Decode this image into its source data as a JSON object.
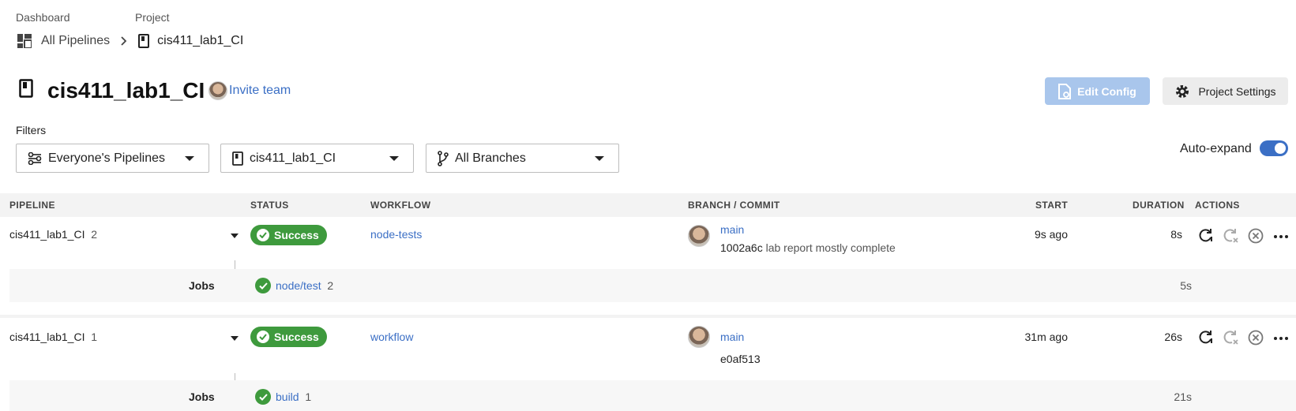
{
  "breadcrumb": {
    "dashboard_label": "Dashboard",
    "project_label": "Project",
    "all_pipelines": "All Pipelines",
    "project_name": "cis411_lab1_CI"
  },
  "header": {
    "title": "cis411_lab1_CI",
    "invite_team": "Invite team",
    "edit_config": "Edit Config",
    "project_settings": "Project Settings"
  },
  "filters": {
    "label": "Filters",
    "pipelines_select": "Everyone's Pipelines",
    "project_select": "cis411_lab1_CI",
    "branches_select": "All Branches",
    "auto_expand_label": "Auto-expand",
    "auto_expand_on": true
  },
  "table": {
    "headers": {
      "pipeline": "PIPELINE",
      "status": "STATUS",
      "workflow": "WORKFLOW",
      "branch_commit": "BRANCH / COMMIT",
      "start": "START",
      "duration": "DURATION",
      "actions": "ACTIONS"
    },
    "rows": [
      {
        "pipeline": "cis411_lab1_CI",
        "number": "2",
        "status": "Success",
        "workflow": "node-tests",
        "branch": "main",
        "commit_hash": "1002a6c",
        "commit_msg": "lab report mostly complete",
        "start": "9s ago",
        "duration": "8s",
        "jobs_label": "Jobs",
        "job_name": "node/test",
        "job_number": "2",
        "job_duration": "5s"
      },
      {
        "pipeline": "cis411_lab1_CI",
        "number": "1",
        "status": "Success",
        "workflow": "workflow",
        "branch": "main",
        "commit_hash": "e0af513",
        "commit_msg": "",
        "start": "31m ago",
        "duration": "26s",
        "jobs_label": "Jobs",
        "job_name": "build",
        "job_number": "1",
        "job_duration": "21s"
      }
    ]
  },
  "colors": {
    "success": "#3e9a3d",
    "link": "#3b6fc5",
    "edit_config_bg": "#a9c6ec",
    "toggle": "#3b6fc5"
  }
}
